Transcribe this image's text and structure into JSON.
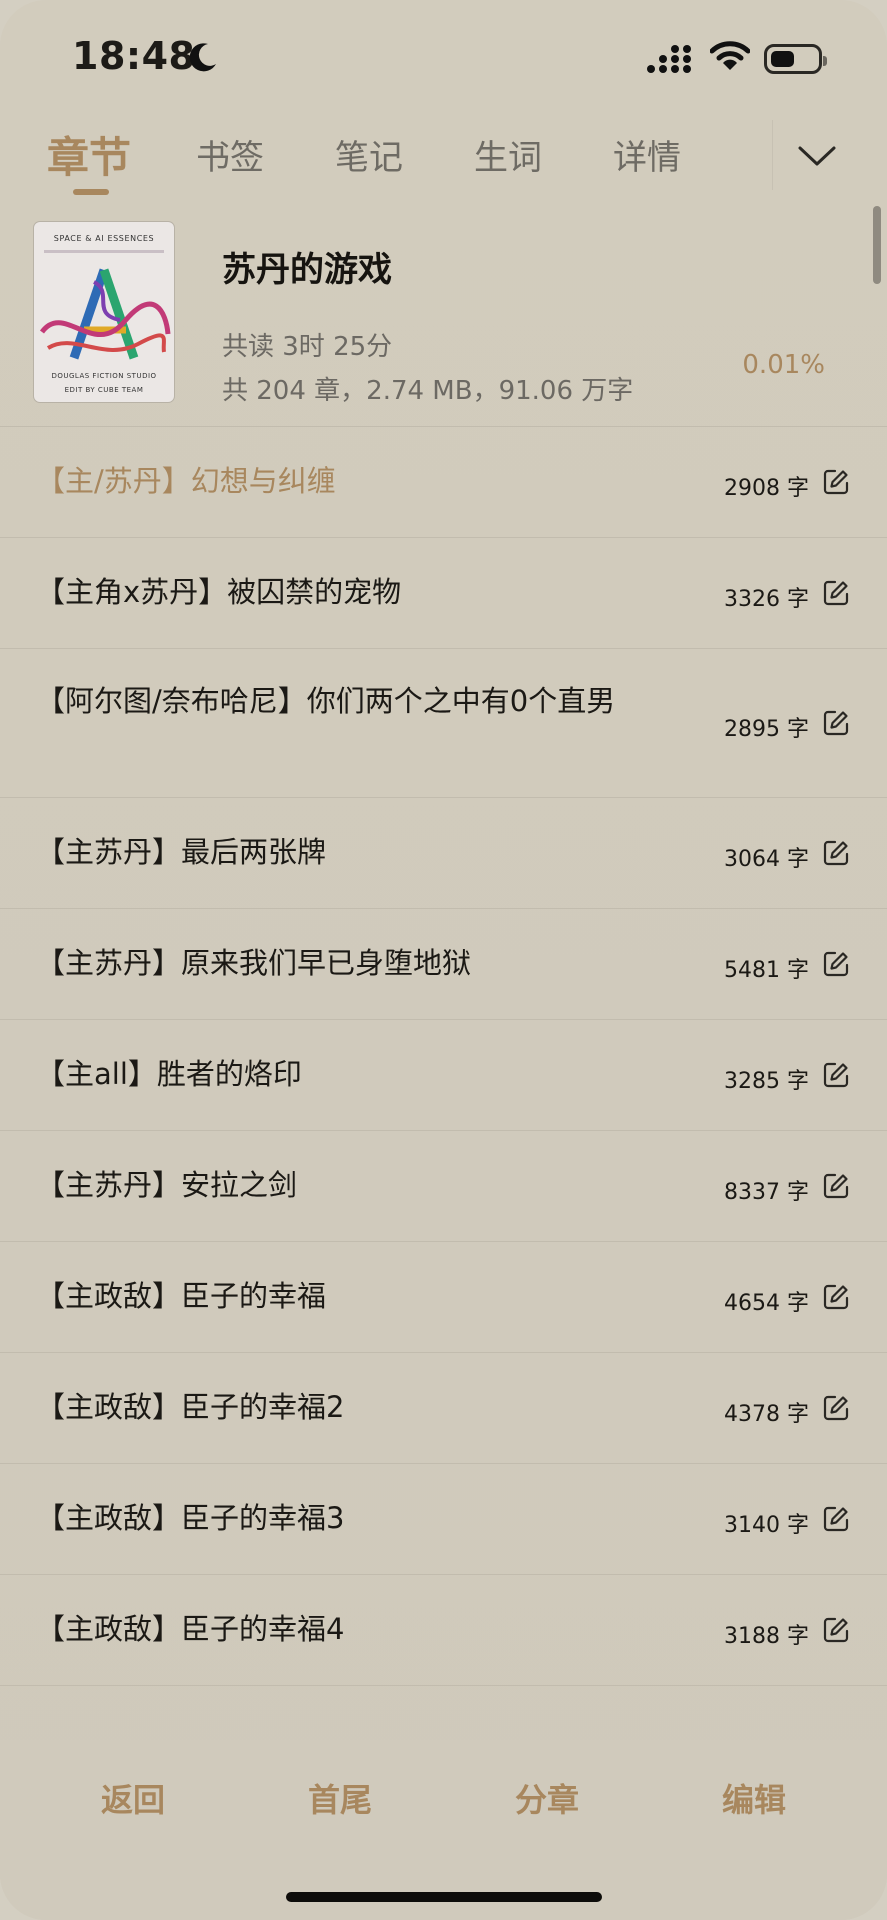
{
  "status_bar": {
    "time": "18:48"
  },
  "tabs": [
    {
      "label": "章节",
      "active": true
    },
    {
      "label": "书签",
      "active": false
    },
    {
      "label": "笔记",
      "active": false
    },
    {
      "label": "生词",
      "active": false
    },
    {
      "label": "详情",
      "active": false
    }
  ],
  "book": {
    "title": "苏丹的游戏",
    "cover": {
      "header": "SPACE & AI ESSENCES",
      "footer_line1": "DOUGLAS  FICTION  STUDIO",
      "footer_line2": "EDIT  BY  CUBE  TEAM"
    },
    "read_time": "共读 3时 25分",
    "meta": "共 204 章，2.74 MB，91.06 万字",
    "progress": "0.01%"
  },
  "chapters": [
    {
      "title": "【主/苏丹】幻想与纠缠",
      "count": "2908 字",
      "current": true
    },
    {
      "title": "【主角x苏丹】被囚禁的宠物",
      "count": "3326 字",
      "current": false
    },
    {
      "title": "【阿尔图/奈布哈尼】你们两个之中有0个直男",
      "count": "2895 字",
      "current": false
    },
    {
      "title": "【主苏丹】最后两张牌",
      "count": "3064 字",
      "current": false
    },
    {
      "title": "【主苏丹】原来我们早已身堕地狱",
      "count": "5481 字",
      "current": false
    },
    {
      "title": "【主all】胜者的烙印",
      "count": "3285 字",
      "current": false
    },
    {
      "title": "【主苏丹】安拉之剑",
      "count": "8337 字",
      "current": false
    },
    {
      "title": "【主政敌】臣子的幸福",
      "count": "4654 字",
      "current": false
    },
    {
      "title": "【主政敌】臣子的幸福2",
      "count": "4378 字",
      "current": false
    },
    {
      "title": "【主政敌】臣子的幸福3",
      "count": "3140 字",
      "current": false
    },
    {
      "title": "【主政敌】臣子的幸福4",
      "count": "3188 字",
      "current": false
    }
  ],
  "toolbar": {
    "back": "返回",
    "ends": "首尾",
    "split": "分章",
    "edit": "编辑"
  },
  "colors": {
    "accent": "#a8875e",
    "background": "#d2ccbd",
    "text": "#1b1915",
    "muted": "#6c6963"
  }
}
